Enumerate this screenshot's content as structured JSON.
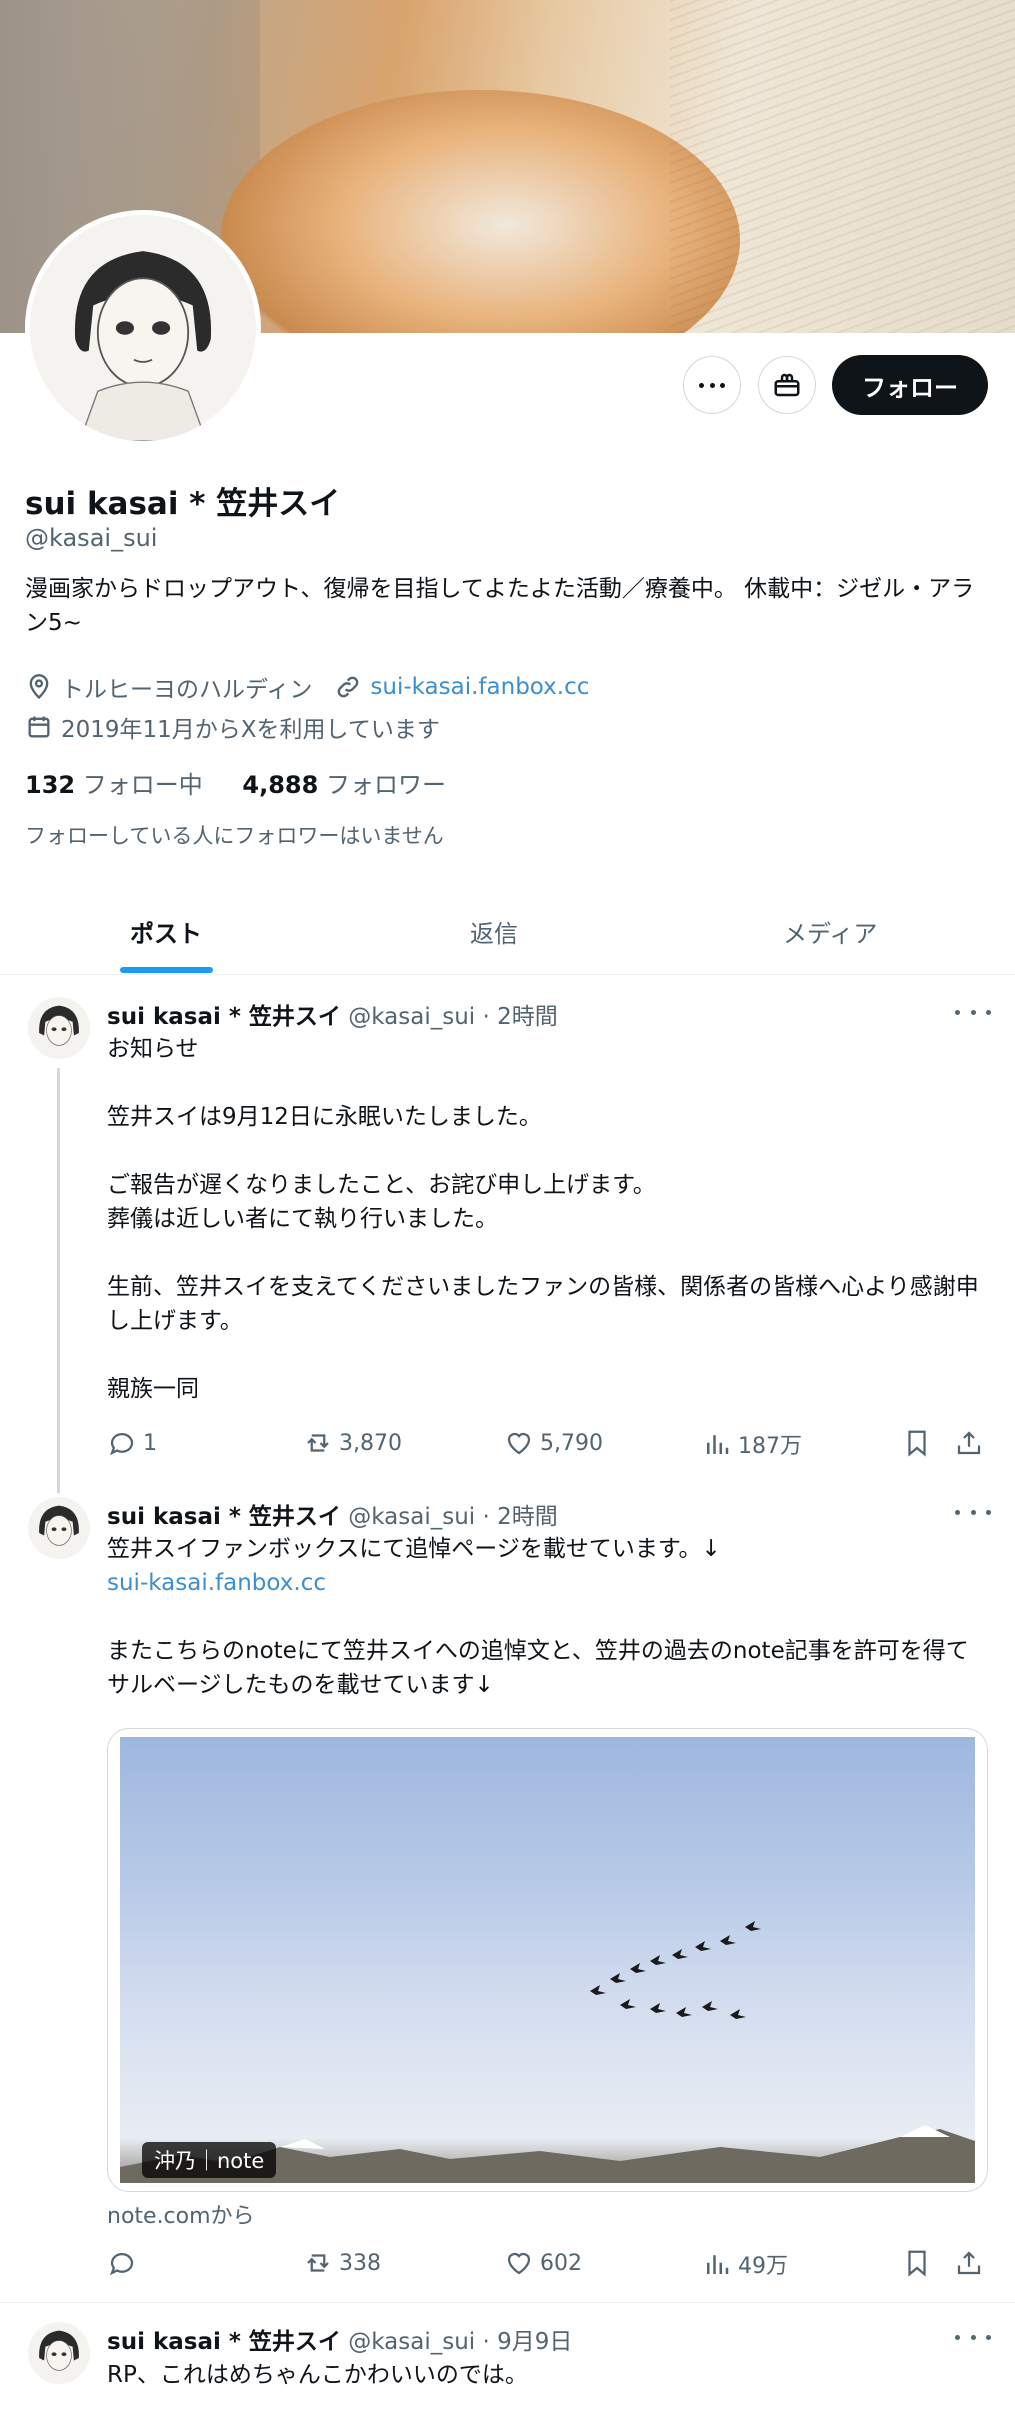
{
  "profile": {
    "name": "sui kasai * 笠井スイ",
    "handle": "@kasai_sui",
    "bio": "漫画家からドロップアウト、復帰を目指してよたよた活動／療養中。 休載中：ジゼル・アラン5~",
    "location": "トルヒーヨのハルディン",
    "website": "sui-kasai.fanbox.cc",
    "joined": "2019年11月からXを利用しています",
    "following_count": "132",
    "following_label": "フォロー中",
    "followers_count": "4,888",
    "followers_label": "フォロワー",
    "followers_you_know": "フォローしている人にフォロワーはいません",
    "follow_button": "フォロー"
  },
  "tabs": [
    "ポスト",
    "返信",
    "メディア"
  ],
  "posts": [
    {
      "name": "sui kasai * 笠井スイ",
      "meta": "@kasai_sui · 2時間",
      "text": "お知らせ\n\n笠井スイは9月12日に永眠いたしました。\n\nご報告が遅くなりましたこと、お詫び申し上げます。\n葬儀は近しい者にて執り行いました。\n\n生前、笠井スイを支えてくださいましたファンの皆様、関係者の皆様へ心より感謝申し上げます。\n\n親族一同",
      "replies": "1",
      "reposts": "3,870",
      "likes": "5,790",
      "views": "187万"
    },
    {
      "name": "sui kasai * 笠井スイ",
      "meta": "@kasai_sui · 2時間",
      "text_line1": "笠井スイファンボックスにて追悼ページを載せています。↓",
      "link": "sui-kasai.fanbox.cc",
      "text_rest": "またこちらのnoteにて笠井スイへの追悼文と、笠井の過去のnote記事を許可を得てサルベージしたものを載せています↓",
      "card_label": "沖乃｜note",
      "card_source": "note.comから",
      "replies": "",
      "reposts": "338",
      "likes": "602",
      "views": "49万"
    },
    {
      "name": "sui kasai * 笠井スイ",
      "meta": "@kasai_sui · 9月9日",
      "text": "RP、これはめちゃんこかわいいのでは。"
    }
  ],
  "colors": {
    "accent": "#1d9bf0",
    "link": "#3b8fd0",
    "text": "#0f1419",
    "muted": "#536471",
    "follow_button_bg": "#0f1419"
  },
  "icons": [
    "more-icon",
    "gift-icon",
    "location-icon",
    "link-icon",
    "calendar-icon",
    "reply-icon",
    "repost-icon",
    "like-icon",
    "views-icon",
    "bookmark-icon",
    "share-icon"
  ]
}
